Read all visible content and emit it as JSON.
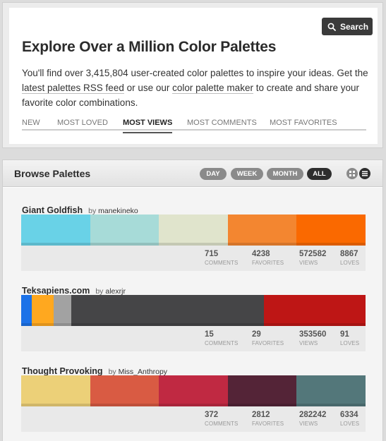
{
  "search": {
    "label": "Search"
  },
  "hero": {
    "title": "Explore Over a Million Color Palettes",
    "text_1": "You'll find over 3,415,804 user-created color palettes to inspire your ideas. Get the ",
    "link_rss": "latest palettes RSS feed",
    "text_2": " or use our ",
    "link_maker": "color palette maker",
    "text_3": " to create and share your favorite color combinations."
  },
  "tabs": [
    {
      "label": "New"
    },
    {
      "label": "Most Loved"
    },
    {
      "label": "Most Views",
      "active": true
    },
    {
      "label": "Most Comments"
    },
    {
      "label": "Most Favorites"
    }
  ],
  "browse": {
    "title": "Browse Palettes",
    "filters": [
      {
        "label": "DAY"
      },
      {
        "label": "WEEK"
      },
      {
        "label": "MONTH"
      },
      {
        "label": "ALL",
        "active": true
      }
    ],
    "view_icons": [
      "grid-view-icon",
      "list-view-icon"
    ]
  },
  "palettes": [
    {
      "name": "Giant Goldfish",
      "by_prefix": "by",
      "author": "manekineko",
      "colors": [
        "#69D2E7",
        "#A7DBD8",
        "#E0E4CC",
        "#F38630",
        "#FA6900"
      ],
      "widths": [
        0.2,
        0.2,
        0.2,
        0.2,
        0.2
      ],
      "comments": "715",
      "favorites": "4238",
      "views": "572582",
      "loves": "8867"
    },
    {
      "name": "Teksapiens.com",
      "by_prefix": "by",
      "author": "alexrjr",
      "colors": [
        "#1C72E8",
        "#FFA81F",
        "#A2A2A2",
        "#454547",
        "#BE1615"
      ],
      "widths": [
        0.03,
        0.065,
        0.05,
        0.56,
        0.295
      ],
      "comments": "15",
      "favorites": "29",
      "views": "353560",
      "loves": "91"
    },
    {
      "name": "Thought Provoking",
      "by_prefix": "by",
      "author": "Miss_Anthropy",
      "colors": [
        "#ECD078",
        "#D95B43",
        "#C02942",
        "#542437",
        "#53777A"
      ],
      "widths": [
        0.2,
        0.2,
        0.2,
        0.2,
        0.2
      ],
      "comments": "372",
      "favorites": "2812",
      "views": "282242",
      "loves": "6334"
    }
  ],
  "stat_labels": {
    "comments": "COMMENTS",
    "favorites": "FAVORITES",
    "views": "VIEWS",
    "loves": "LOVES"
  }
}
